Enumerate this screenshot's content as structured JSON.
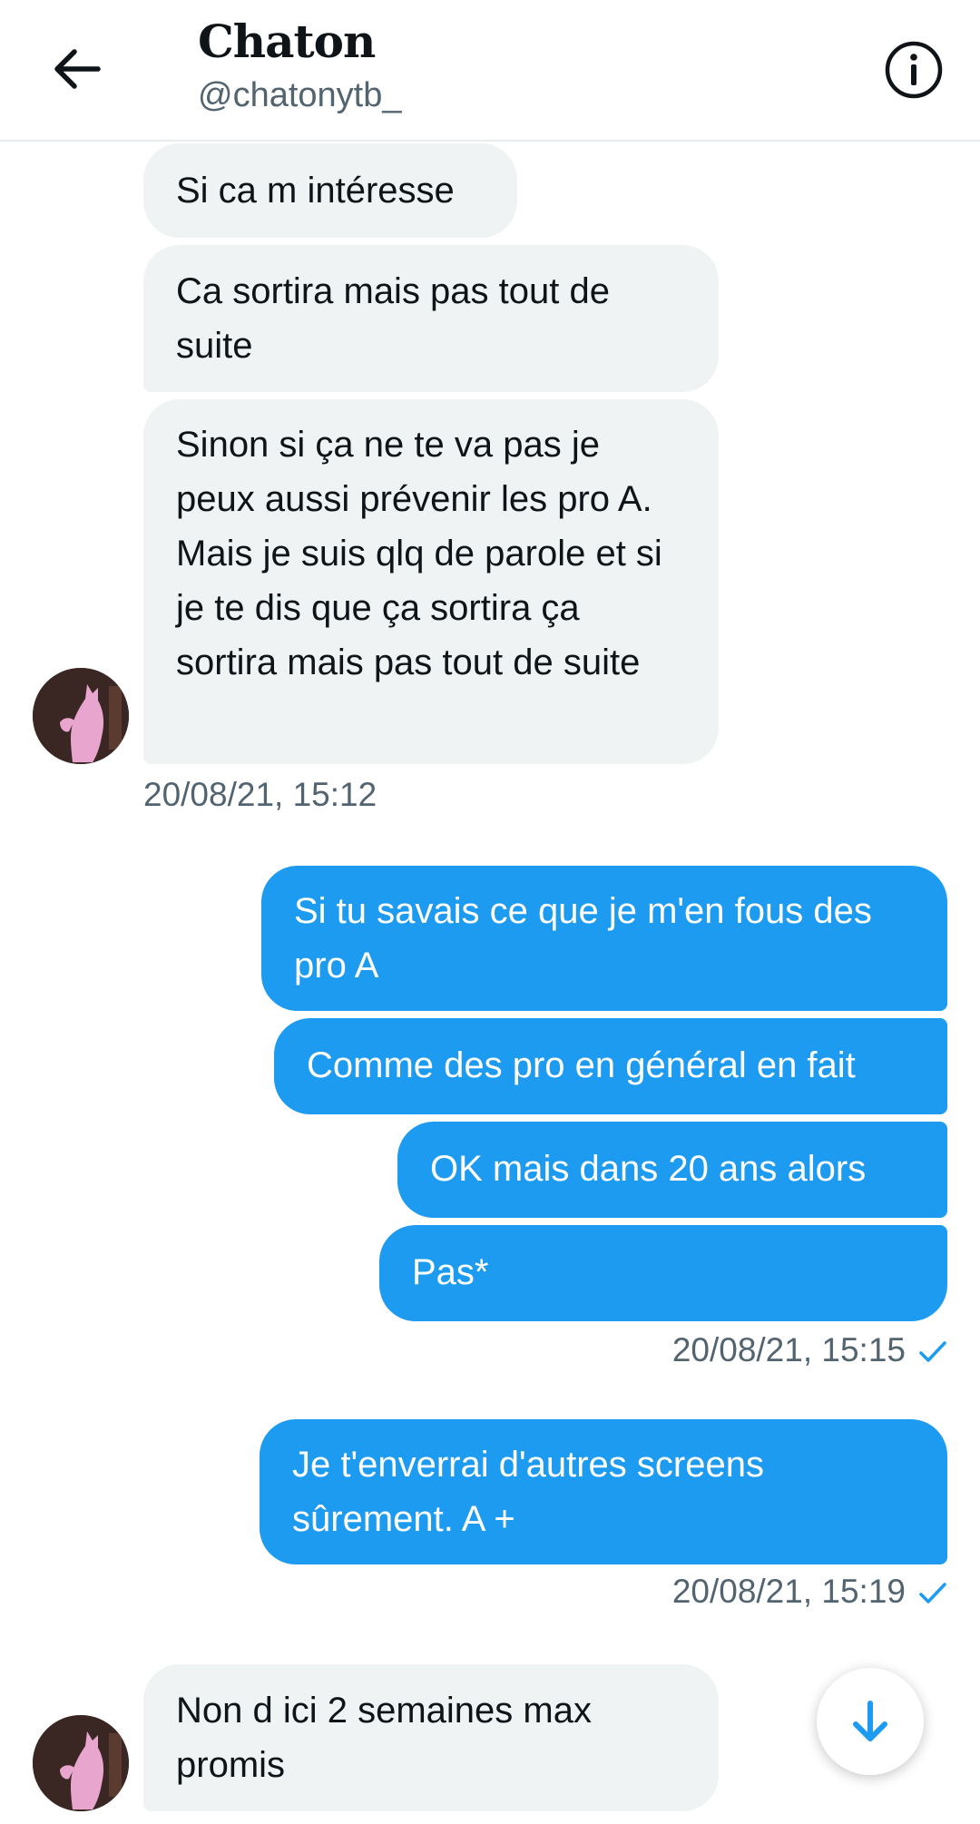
{
  "header": {
    "title": "Chaton",
    "handle": "@chatonytb_",
    "back_icon": "back-arrow-icon",
    "info_icon": "info-icon"
  },
  "messages": [
    {
      "direction": "in",
      "text": "Si ca m intéresse"
    },
    {
      "direction": "in",
      "text": "Ca sortira mais pas tout de suite"
    },
    {
      "direction": "in",
      "text": "Sinon si ça ne te va pas je peux aussi prévenir les pro A. Mais je suis qlq de parole et si je te dis que ça sortira ça sortira mais pas tout de suite"
    },
    {
      "direction": "in_timestamp",
      "text": "20/08/21, 15:12"
    },
    {
      "direction": "out",
      "text": "Si tu savais ce que je m'en fous des pro A"
    },
    {
      "direction": "out",
      "text": "Comme des pro en général en fait"
    },
    {
      "direction": "out",
      "text": "OK mais dans 20 ans alors"
    },
    {
      "direction": "out",
      "text": "Pas*"
    },
    {
      "direction": "out_timestamp",
      "text": "20/08/21, 15:15"
    },
    {
      "direction": "out",
      "text": "Je t'enverrai d'autres screens sûrement. A +"
    },
    {
      "direction": "out_timestamp",
      "text": "20/08/21, 15:19"
    },
    {
      "direction": "in",
      "text": "Non d ici 2 semaines max promis"
    }
  ],
  "colors": {
    "outgoing_bubble": "#1d9bf0",
    "incoming_bubble": "#eff3f4",
    "timestamp": "#536471",
    "read_check": "#1d9bf0"
  },
  "scroll_button_icon": "arrow-down-icon"
}
